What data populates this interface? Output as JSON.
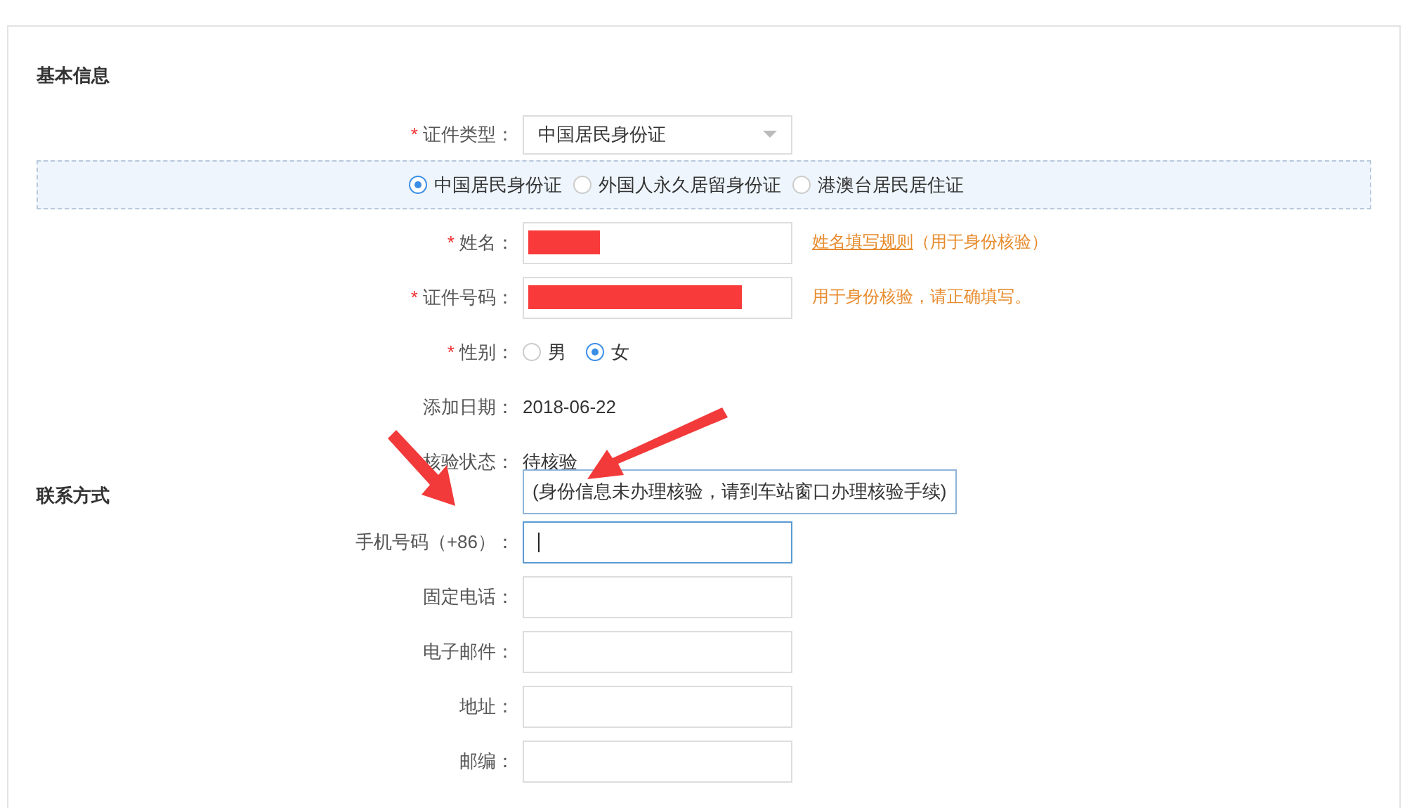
{
  "sections": [
    {
      "title": "基本信息",
      "rows": [
        {
          "kind": "select",
          "label": "证件类型：",
          "marker": "*",
          "value": "中国居民身份证"
        },
        {
          "kind": "radio-band",
          "options": [
            {
              "label": "中国居民身份证",
              "selected": true
            },
            {
              "label": "外国人永久居留身份证",
              "selected": false
            },
            {
              "label": "港澳台居民居住证",
              "selected": false
            }
          ]
        },
        {
          "kind": "text",
          "label": "姓名：",
          "marker": "*",
          "redacted": true,
          "link": "姓名填写规则",
          "hint": "（用于身份核验）"
        },
        {
          "kind": "text",
          "label": "证件号码：",
          "marker": "*",
          "redacted": true,
          "hint": "用于身份核验，请正确填写。"
        },
        {
          "kind": "radio",
          "label": "性别：",
          "marker": "*",
          "options": [
            {
              "label": "男",
              "selected": false
            },
            {
              "label": "女",
              "selected": true
            }
          ]
        },
        {
          "kind": "static",
          "label": "添加日期：",
          "value": "2018-06-22"
        },
        {
          "kind": "static",
          "label": "核验状态：",
          "value": "待核验",
          "tooltip": "(身份信息未办理核验，请到车站窗口办理核验手续)"
        }
      ]
    },
    {
      "title": "联系方式",
      "rows": [
        {
          "kind": "text",
          "label": "手机号码（+86）：",
          "focused": true
        },
        {
          "kind": "text",
          "label": "固定电话：",
          "focused": false
        },
        {
          "kind": "text",
          "label": "电子邮件：",
          "focused": false
        },
        {
          "kind": "text",
          "label": "地址：",
          "focused": false
        },
        {
          "kind": "text",
          "label": "邮编：",
          "focused": false
        }
      ]
    }
  ]
}
